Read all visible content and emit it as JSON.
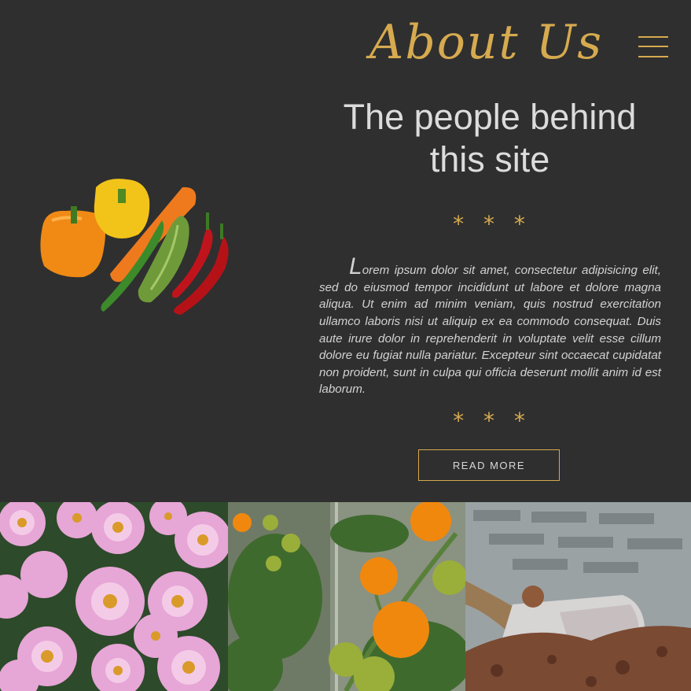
{
  "header": {
    "brand": "About Us",
    "menu_icon": "hamburger-menu-icon"
  },
  "hero": {
    "image_icon": "vegetables-image",
    "heading": "The people behind this site",
    "divider": "* * *",
    "paragraph": "Lorem ipsum dolor sit amet, consectetur adipisicing elit, sed do eiusmod tempor incididunt ut labore et dolore magna aliqua. Ut enim ad minim veniam, quis nostrud exercitation ullamco laboris nisi ut aliquip ex ea commodo consequat. Duis aute irure dolor in reprehenderit in voluptate velit esse cillum dolore eu fugiat nulla pariatur. Excepteur sint occaecat cupidatat non proident, sunt in culpa qui officia deserunt mollit anim id est laborum.",
    "read_more_label": "READ MORE"
  },
  "gallery": [
    {
      "icon": "pink-flowers-photo"
    },
    {
      "icon": "tomatoes-photo"
    },
    {
      "icon": "shovel-soil-photo"
    }
  ],
  "colors": {
    "background": "#2f2f2f",
    "accent": "#d6aa4f",
    "text": "#d2d2d2"
  }
}
